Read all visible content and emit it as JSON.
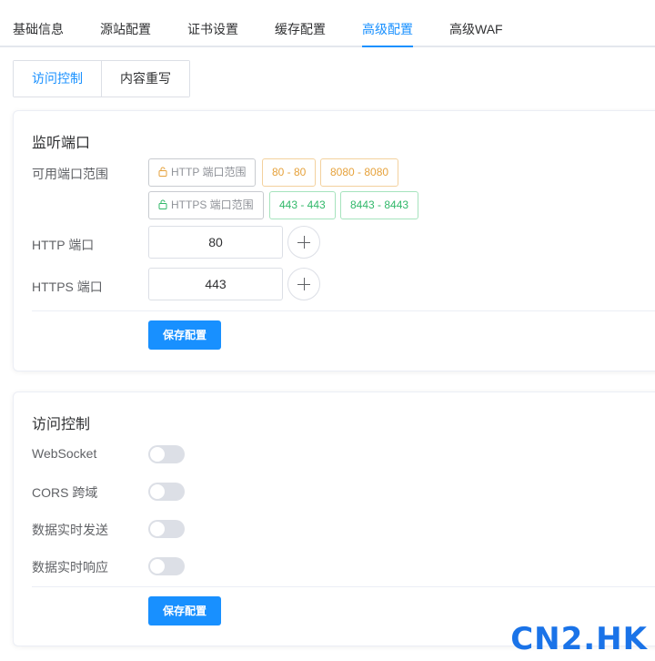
{
  "tabs": [
    "基础信息",
    "源站配置",
    "证书设置",
    "缓存配置",
    "高级配置",
    "高级WAF"
  ],
  "active_tab": "高级配置",
  "sub_tabs": [
    "访问控制",
    "内容重写"
  ],
  "active_sub_tab": "访问控制",
  "listen": {
    "title": "监听端口",
    "range_label": "可用端口范围",
    "http_range_tag": "HTTP 端口范围",
    "http_ranges": [
      "80 - 80",
      "8080 - 8080"
    ],
    "https_range_tag": "HTTPS 端口范围",
    "https_ranges": [
      "443 - 443",
      "8443 - 8443"
    ],
    "http_port_label": "HTTP 端口",
    "http_port_value": "80",
    "https_port_label": "HTTPS 端口",
    "https_port_value": "443",
    "save_label": "保存配置"
  },
  "access": {
    "title": "访问控制",
    "switches": [
      {
        "label": "WebSocket",
        "enabled": false
      },
      {
        "label": "CORS 跨域",
        "enabled": false
      },
      {
        "label": "数据实时发送",
        "enabled": false
      },
      {
        "label": "数据实时响应",
        "enabled": false
      }
    ],
    "save_label": "保存配置"
  },
  "watermark": "CN2.HK",
  "colors": {
    "accent": "#1890ff",
    "orange": "#e6a23c",
    "green": "#31b86a"
  }
}
